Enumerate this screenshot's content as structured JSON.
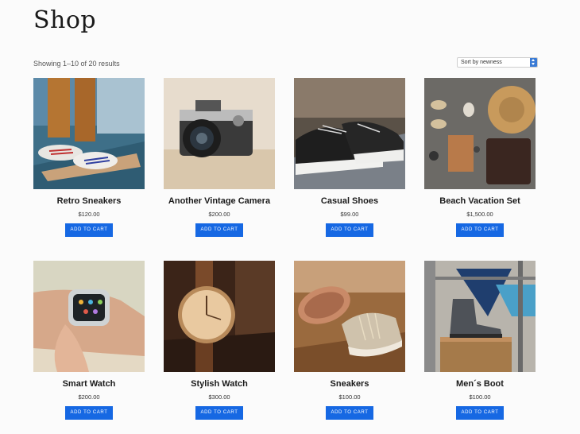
{
  "page": {
    "title": "Shop",
    "result_count": "Showing 1–10 of 20 results",
    "sort": {
      "selected": "Sort by newness"
    }
  },
  "products": [
    {
      "name": "Retro Sneakers",
      "price": "$120.00",
      "cta": "ADD TO CART"
    },
    {
      "name": "Another Vintage Camera",
      "price": "$200.00",
      "cta": "ADD TO CART"
    },
    {
      "name": "Casual Shoes",
      "price": "$99.00",
      "cta": "ADD TO CART"
    },
    {
      "name": "Beach Vacation Set",
      "price": "$1,500.00",
      "cta": "ADD TO CART"
    },
    {
      "name": "Smart Watch",
      "price": "$200.00",
      "cta": "ADD TO CART"
    },
    {
      "name": "Stylish Watch",
      "price": "$300.00",
      "cta": "ADD TO CART"
    },
    {
      "name": "Sneakers",
      "price": "$100.00",
      "cta": "ADD TO CART"
    },
    {
      "name": "Men´s Boot",
      "price": "$100.00",
      "cta": "ADD TO CART"
    }
  ],
  "colors": {
    "accent": "#1668e3",
    "background": "#fbfbfb"
  }
}
